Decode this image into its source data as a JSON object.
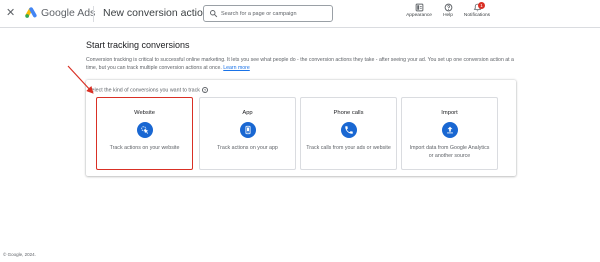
{
  "header": {
    "close_icon": "close-icon",
    "brand": "Google Ads",
    "title": "New conversion action",
    "search_placeholder": "Search for a page or campaign",
    "appearance_label": "Appearance",
    "help_label": "Help",
    "notifications_label": "Notifications",
    "notifications_count": "1"
  },
  "main": {
    "heading": "Start tracking conversions",
    "description": "Conversion tracking is critical to successful online marketing. It lets you see what people do - the conversion actions they take - after seeing your ad. You set up one conversion action at a time, but you can track multiple conversion actions at once.",
    "learn_more": "Learn more",
    "select_label": "Select the kind of conversions you want to track",
    "cards": [
      {
        "title": "Website",
        "description": "Track actions on your website",
        "icon": "website-cursor-icon",
        "selected": true
      },
      {
        "title": "App",
        "description": "Track actions on your app",
        "icon": "mobile-app-icon",
        "selected": false
      },
      {
        "title": "Phone calls",
        "description": "Track calls from your ads or website",
        "icon": "phone-icon",
        "selected": false
      },
      {
        "title": "Import",
        "description": "Import data from Google Analytics or another source",
        "icon": "upload-icon",
        "selected": false
      }
    ]
  },
  "footer": {
    "copyright": "© Google, 2024."
  },
  "colors": {
    "accent": "#1967d2",
    "highlight": "#d93025",
    "link": "#1a73e8"
  }
}
